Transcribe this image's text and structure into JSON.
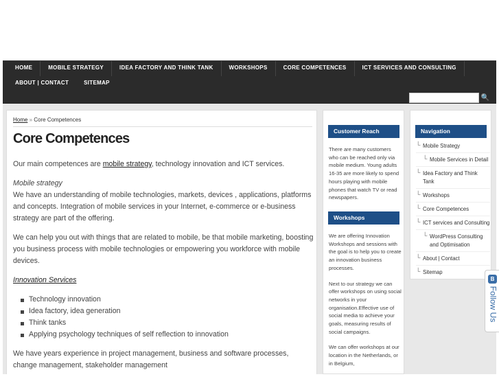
{
  "nav": {
    "row1": [
      "HOME",
      "MOBILE STRATEGY",
      "IDEA FACTORY AND THINK TANK",
      "WORKSHOPS",
      "CORE COMPETENCES",
      "ICT SERVICES AND CONSULTING"
    ],
    "row2": [
      "ABOUT | CONTACT",
      "SITEMAP"
    ]
  },
  "search": {
    "button_glyph": "🔍"
  },
  "breadcrumb": {
    "home": "Home",
    "sep": "»",
    "current": "Core Competences"
  },
  "page": {
    "title": "Core Competences",
    "intro_before": "Our main competences are ",
    "intro_link": "mobile strategy",
    "intro_after": ", technology innovation and ICT services.",
    "mobile_heading": "Mobile strategy",
    "mobile_text": "We have an understanding of mobile technologies, markets, devices , applications, platforms and concepts. Integration of mobile services in your Internet, e-commerce or  e-business strategy are part of the offering.",
    "help_text": "We can help you out with things that are related to mobile,  be that mobile marketing,  boosting you business process with mobile technologies or empowering you workforce with mobile devices.",
    "innovation_heading": "Innovation Services",
    "innovation_items": [
      "Technology innovation",
      "Idea factory, idea generation",
      "Think tanks",
      "Applying psychology techniques of self reflection to innovation"
    ],
    "experience_text": "We have years experience in project management, business and software processes, change management, stakeholder management"
  },
  "customer_reach": {
    "title": "Customer Reach",
    "text": "There are many customers who can be reached only via mobile medium. Young adults 16-35 are more likely to spend hours playing with mobile phones that watch TV or read newspapers."
  },
  "workshops": {
    "title": "Workshops",
    "paragraphs": [
      "We are offering Innovation Workshops and sessions with the goal is to help you to create an innovation business processes.",
      "Next to our strategy we can offer workshops on using social networks in your organisation.Effective use of social media to achieve your goals, measuring results of social campaigns.",
      "We can offer workshops at our location in the Netherlands, or in Belgium,"
    ]
  },
  "navigation_widget": {
    "title": "Navigation",
    "items": [
      {
        "label": "Mobile Strategy",
        "level": 0
      },
      {
        "label": "Mobile Services in Detail",
        "level": 1
      },
      {
        "label": "Idea Factory and Think Tank",
        "level": 0
      },
      {
        "label": "Workshops",
        "level": 0
      },
      {
        "label": "Core Competences",
        "level": 0
      },
      {
        "label": "ICT services and Consulting",
        "level": 0
      },
      {
        "label": "WordPress Consulting and Optimisation",
        "level": 1
      },
      {
        "label": "About | Contact",
        "level": 0
      },
      {
        "label": "Sitemap",
        "level": 0
      }
    ]
  },
  "follow": {
    "label": "Follow Us",
    "icon_letter": "B"
  },
  "colors": {
    "navbar": "#2b2b2b",
    "widget_title": "#1e4f87",
    "follow": "#3a6ea8"
  }
}
